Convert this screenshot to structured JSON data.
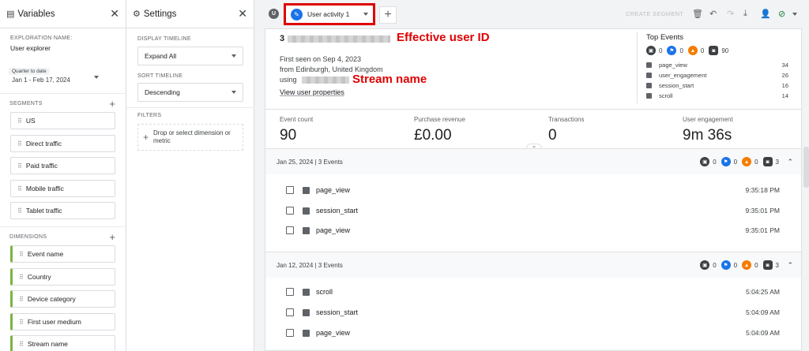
{
  "variables": {
    "title": "Variables",
    "exploration_name_label": "EXPLORATION NAME:",
    "exploration_name": "User explorer",
    "date_label": "Quarter to date",
    "date_range": "Jan 1 - Feb 17, 2024",
    "segments_label": "SEGMENTS",
    "segments": [
      "US",
      "Direct traffic",
      "Paid traffic",
      "Mobile traffic",
      "Tablet traffic"
    ],
    "dimensions_label": "DIMENSIONS",
    "dimensions": [
      "Event name",
      "Country",
      "Device category",
      "First user medium",
      "Stream name"
    ]
  },
  "settings": {
    "title": "Settings",
    "display_timeline_label": "DISPLAY TIMELINE",
    "display_timeline_value": "Expand All",
    "sort_timeline_label": "SORT TIMELINE",
    "sort_timeline_value": "Descending",
    "filters_label": "FILTERS",
    "filters_drop_text": "Drop or select dimension or metric"
  },
  "toolbar": {
    "user_initial": "U",
    "tab_label": "User activity 1",
    "create_segment": "CREATE SEGMENT"
  },
  "user": {
    "id_prefix": "3",
    "first_seen": "First seen on Sep 4, 2023",
    "location": "from Edinburgh, United Kingdom",
    "using_prefix": "using",
    "view_props": "View user properties",
    "annotation_id": "Effective user ID",
    "annotation_stream": "Stream name"
  },
  "top_events": {
    "title": "Top Events",
    "counts": {
      "general": "0",
      "conversion": "0",
      "error": "0",
      "other": "90"
    },
    "rows": [
      {
        "name": "page_view",
        "count": "34"
      },
      {
        "name": "user_engagement",
        "count": "26"
      },
      {
        "name": "session_start",
        "count": "16"
      },
      {
        "name": "scroll",
        "count": "14"
      }
    ]
  },
  "metrics": [
    {
      "label": "Event count",
      "value": "90"
    },
    {
      "label": "Purchase revenue",
      "value": "£0.00"
    },
    {
      "label": "Transactions",
      "value": "0"
    },
    {
      "label": "User engagement",
      "value": "9m 36s"
    }
  ],
  "days": [
    {
      "header": "Jan 25, 2024 | 3 Events",
      "counts": {
        "general": "0",
        "conversion": "0",
        "error": "0",
        "other": "3"
      },
      "events": [
        {
          "name": "page_view",
          "time": "9:35:18 PM"
        },
        {
          "name": "session_start",
          "time": "9:35:01 PM"
        },
        {
          "name": "page_view",
          "time": "9:35:01 PM"
        }
      ]
    },
    {
      "header": "Jan 12, 2024 | 3 Events",
      "counts": {
        "general": "0",
        "conversion": "0",
        "error": "0",
        "other": "3"
      },
      "events": [
        {
          "name": "scroll",
          "time": "5:04:25 AM"
        },
        {
          "name": "session_start",
          "time": "5:04:09 AM"
        },
        {
          "name": "page_view",
          "time": "5:04:09 AM"
        }
      ]
    }
  ],
  "colors": {
    "accent": "#1a73e8",
    "annotation": "#e00000",
    "error": "#f57c00",
    "dimension": "#7cb342"
  }
}
